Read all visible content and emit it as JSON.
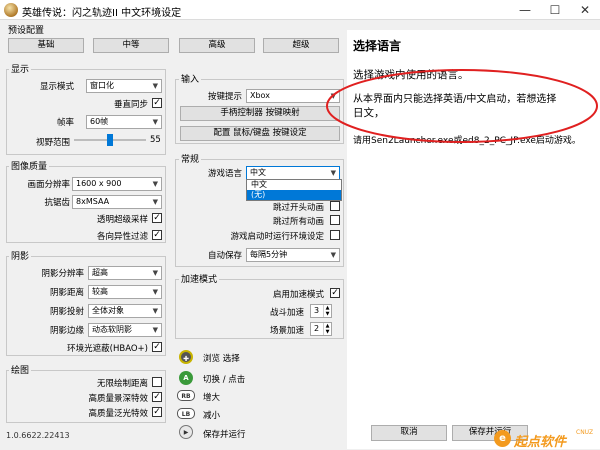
{
  "window": {
    "title": "英雄传说：闪之轨迹II 中文环境设定"
  },
  "presets": {
    "group_label": "预设配置",
    "buttons": [
      "基础",
      "中等",
      "高级",
      "超级"
    ]
  },
  "display": {
    "group_label": "显示",
    "mode_label": "显示模式",
    "mode_value": "窗口化",
    "vsync_label": "垂直同步",
    "fps_label": "帧率",
    "fps_value": "60帧",
    "fov_label": "视野范围",
    "fov_value": "55",
    "fov_level": 0.55
  },
  "quality": {
    "group_label": "图像质量",
    "resolution_label": "画面分辨率",
    "resolution_value": "1600 x 900",
    "aa_label": "抗锯齿",
    "aa_value": "8xMSAA",
    "transparent_ss_label": "透明超级采样",
    "aniso_label": "各向异性过滤"
  },
  "shadow": {
    "group_label": "阴影",
    "res_label": "阴影分辨率",
    "res_value": "超高",
    "dist_label": "阴影距离",
    "dist_value": "较高",
    "proj_label": "阴影投射",
    "proj_value": "全体对象",
    "blur_label": "阴影边缘",
    "blur_value": "动态软阴影",
    "hbao_label": "环境光遮蔽(HBAO+)"
  },
  "draw": {
    "group_label": "绘图",
    "infinite_label": "无限绘制距离",
    "dof_label": "高质量景深特效",
    "bloom_label": "高质量泛光特效"
  },
  "input": {
    "group_label": "输入",
    "hint_label": "按键提示",
    "hint_value": "Xbox",
    "map_button": "手柄控制器 按键映射",
    "kb_button": "配置 鼠标/键盘 按键设定"
  },
  "general": {
    "group_label": "常规",
    "lang_label": "游戏语言",
    "lang_value": "中文",
    "lang_options": [
      "中文",
      "(无)"
    ],
    "skip_op_label": "跳过开头动画",
    "skip_all_label": "跳过所有动画",
    "env_label": "游戏启动时运行环境设定",
    "autosave_label": "自动保存",
    "autosave_value": "每隔5分钟"
  },
  "accel": {
    "group_label": "加速模式",
    "enable_label": "启用加速模式",
    "battle_label": "战斗加速",
    "battle_value": "3",
    "field_label": "场景加速",
    "field_value": "2"
  },
  "controls": [
    {
      "icon": "dpad-icon",
      "label": "浏览 选择"
    },
    {
      "icon": "a-button-icon",
      "glyph": "A",
      "label": "切换 / 点击"
    },
    {
      "icon": "rb-button-icon",
      "glyph": "RB",
      "label": "增大"
    },
    {
      "icon": "lb-button-icon",
      "glyph": "LB",
      "label": "减小"
    },
    {
      "icon": "start-button-icon",
      "glyph": "▶",
      "label": "保存并运行"
    }
  ],
  "help": {
    "title": "选择语言",
    "line1": "选择游戏内使用的语言。",
    "line2": "从本界面内只能选择英语/中文启动，若想选择",
    "line3": "日文，",
    "line4": "请用Sen2Launcher.exe或ed8_2_PC_JP.exe启动游戏。"
  },
  "footer": {
    "version": "1.0.6622.22413",
    "cancel": "取消",
    "save_run": "保存并运行"
  },
  "colors": {
    "accent": "#0078d7",
    "annotation": "#e02020",
    "logo_orange": "#f39a1e"
  },
  "logo": {
    "text": "起点软件",
    "sub": "CNUZ"
  }
}
